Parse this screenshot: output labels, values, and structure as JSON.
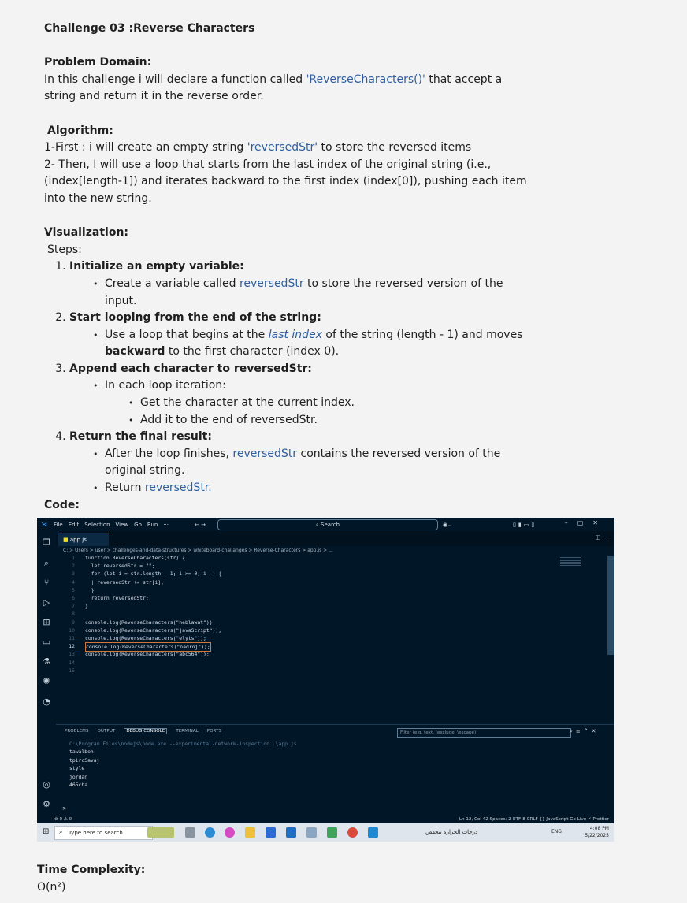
{
  "doc": {
    "title": "Challenge 03 :Reverse Characters",
    "problem_heading": "Problem Domain:",
    "problem_text_1": "In this challenge i will declare a function called ",
    "problem_fn": "'ReverseCharacters()'",
    "problem_text_2": "  that accept a",
    "problem_text_3": "string and return it in the reverse order.",
    "algorithm_heading": "Algorithm:",
    "algo_1a": "1-First : i will create an empty string ",
    "algo_1_var": "'reversedStr'",
    "algo_1b": " to store the reversed items",
    "algo_2a": "2- Then, I will use a loop that starts from the last index of the original string (i.e.,",
    "algo_2b": "(index[length-1]) and iterates backward to the first index (index[0]), pushing each item",
    "algo_2c": "into the new string.",
    "viz_heading": "Visualization:",
    "steps_label": "Steps:",
    "step1_title": "Initialize an empty variable:",
    "step1_a": "Create a variable called ",
    "step1_var": "reversedStr",
    "step1_b": " to store the reversed version of the",
    "step1_c": "input.",
    "step2_title": "Start looping from the end of the string:",
    "step2_a": "Use a loop that begins at the ",
    "step2_it": "last index",
    "step2_b": " of the string (length - 1) and moves",
    "step2_bold": "backward",
    "step2_c": " to the first character (index 0).",
    "step3_title": "Append each character to reversedStr:",
    "step3_a": "In each loop iteration:",
    "step3_sub1": "Get the character at the current index.",
    "step3_sub2": "Add it to the end of reversedStr.",
    "step4_title": "Return the final result:",
    "step4_a": "After the loop finishes, ",
    "step4_var": "reversedStr",
    "step4_b": " contains the reversed version of the",
    "step4_c": "original string.",
    "step4_d": "Return ",
    "step4_var2": "reversedStr.",
    "code_heading": "Code:",
    "tc_heading": "Time Complexity:",
    "tc_value": "O(n²)"
  },
  "vscode": {
    "menu": [
      "File",
      "Edit",
      "Selection",
      "View",
      "Go",
      "Run",
      "···"
    ],
    "search": "⌕ Search",
    "tab": "app.js",
    "breadcrumb": "C: > Users > user > challenges-and-data-structures > whiteboard-challanges > Reverse-Characters > app.js > ...",
    "lines": [
      "function ReverseCharacters(str) {",
      "  let reversedStr = \"\";",
      "  for (let i = str.length - 1; i >= 0; i--) {",
      "  | reversedStr += str[i];",
      "  }",
      "  return reversedStr;",
      "}",
      "",
      "console.log(ReverseCharacters(\"heblawat\"));",
      "console.log(ReverseCharacters(\"javaScript\"));",
      "console.log(ReverseCharacters(\"elyts\"));",
      "console.log(ReverseCharacters(\"nadroj\"));",
      "console.log(ReverseCharacters(\"abc564\"));",
      "",
      ""
    ],
    "panel_tabs": [
      "PROBLEMS",
      "OUTPUT",
      "DEBUG CONSOLE",
      "TERMINAL",
      "PORTS"
    ],
    "filter_placeholder": "Filter (e.g. text, !exclude, \\escape)",
    "command": "C:\\Program Files\\nodejs\\node.exe --experimental-network-inspection .\\app.js",
    "output": [
      "tawalbeh",
      "tpircSavaj",
      "style",
      "jordan",
      "465cba"
    ],
    "status_left": "⊗ 0 ⚠ 0",
    "status_right": "Ln 12, Col 42   Spaces: 2   UTF-8   CRLF   {} JavaScript   Go Live   ✓ Prettier",
    "taskbar_search": "Type here to search",
    "taskbar_rtl": "درجات الحرارة تنخفض",
    "taskbar_lang": "ENG",
    "time": "4:08 PM",
    "date": "5/22/2025"
  }
}
